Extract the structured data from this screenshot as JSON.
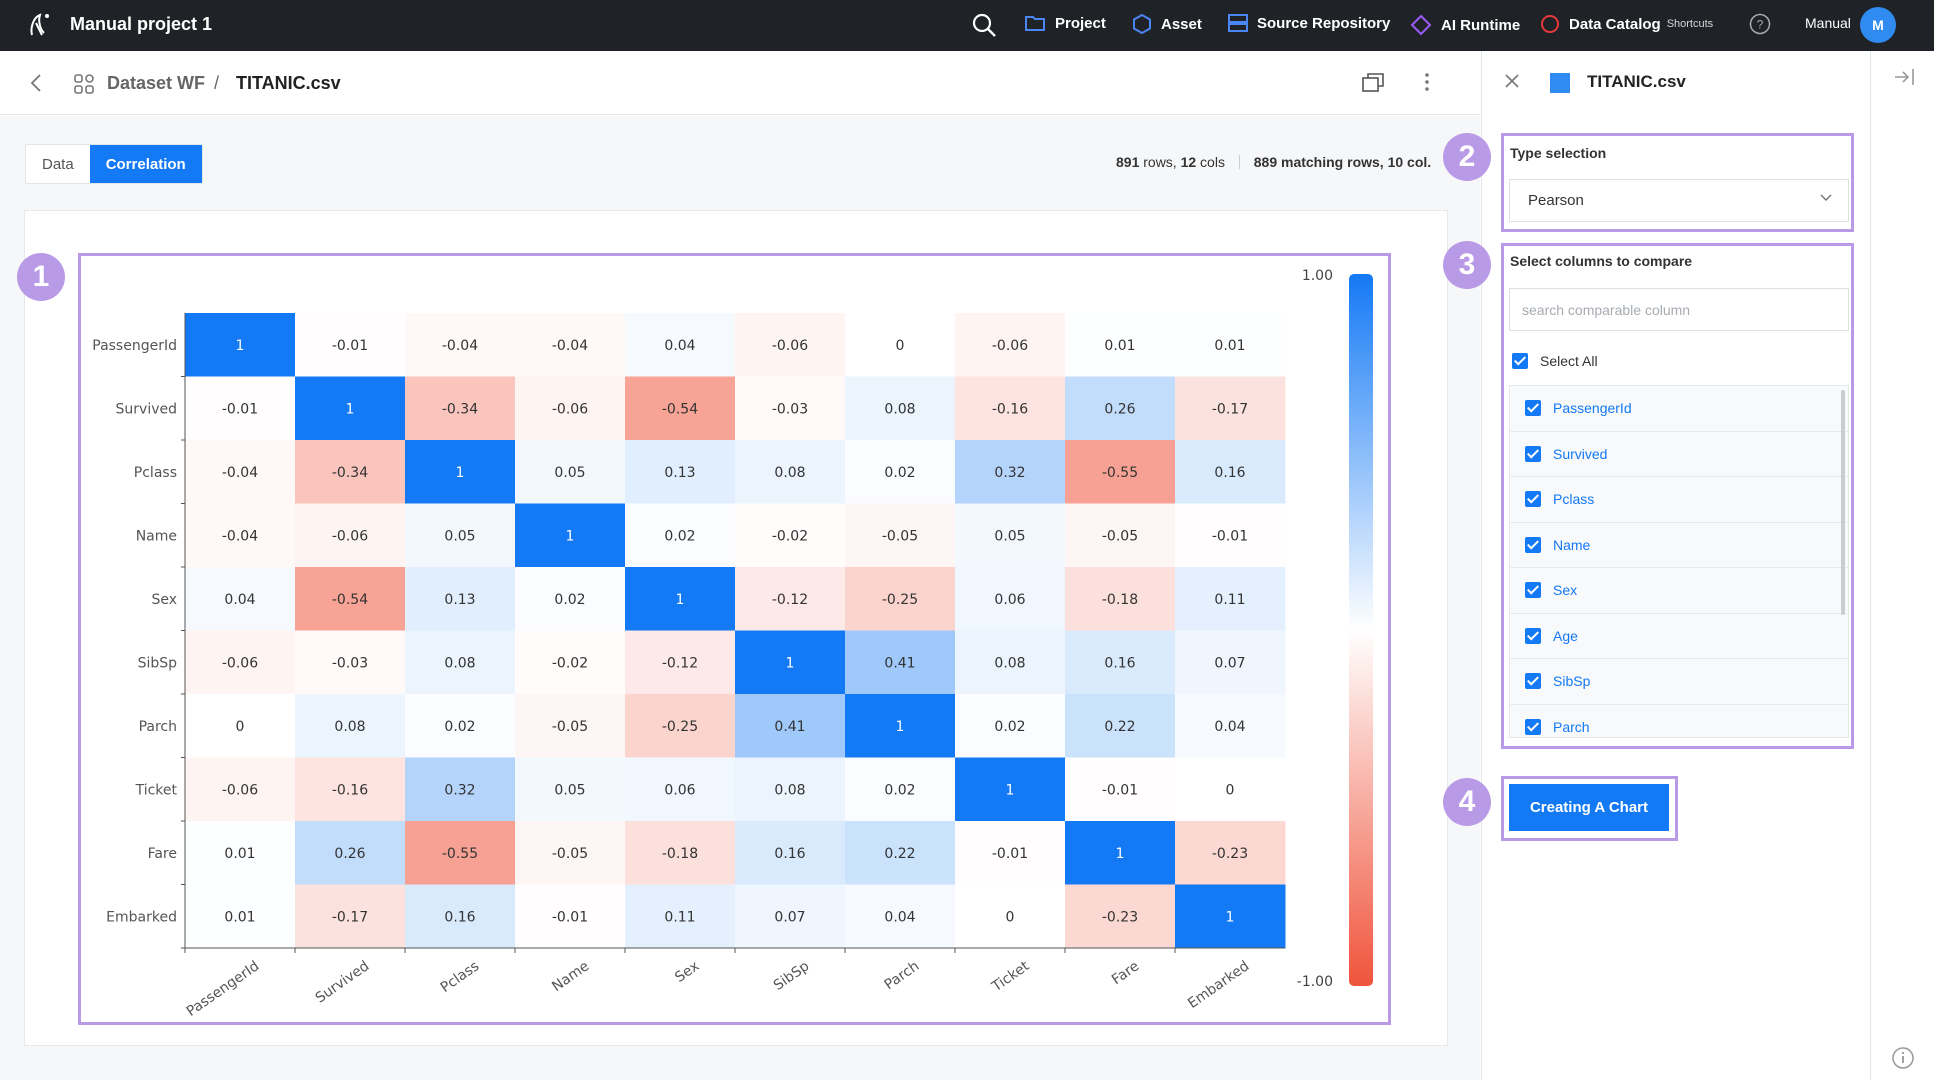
{
  "topbar": {
    "project_title": "Manual project 1",
    "nav": [
      {
        "label": "Project",
        "icon": "folder-icon"
      },
      {
        "label": "Asset",
        "icon": "hexagon-icon"
      },
      {
        "label": "Source Repository",
        "icon": "repository-icon"
      },
      {
        "label": "AI Runtime",
        "icon": "diamond-icon"
      },
      {
        "label": "Data Catalog",
        "icon": "catalog-icon"
      }
    ],
    "shortcuts_label": "Shortcuts",
    "user_name": "Manual",
    "avatar_initial": "M"
  },
  "breadcrumb": {
    "parent": "Dataset WF",
    "separator": "/",
    "current": "TITANIC.csv"
  },
  "tabs": [
    {
      "label": "Data",
      "active": false
    },
    {
      "label": "Correlation",
      "active": true
    }
  ],
  "row_info": {
    "rows": "891",
    "rows_label": " rows, ",
    "cols": "12",
    "cols_label": " cols",
    "matching": "889 matching rows, 10 col."
  },
  "badges": [
    "1",
    "2",
    "3",
    "4"
  ],
  "colors": {
    "accent": "#1479f5",
    "positive": "#1479f5",
    "negative": "#f0543c",
    "highlight": "#b99ae6",
    "topbar": "#1f2227"
  },
  "chart_data": {
    "type": "heatmap",
    "labels": [
      "PassengerId",
      "Survived",
      "Pclass",
      "Name",
      "Sex",
      "SibSp",
      "Parch",
      "Ticket",
      "Fare",
      "Embarked"
    ],
    "values": [
      [
        1,
        -0.01,
        -0.04,
        -0.04,
        0.04,
        -0.06,
        0,
        -0.06,
        0.01,
        0.01
      ],
      [
        -0.01,
        1,
        -0.34,
        -0.06,
        -0.54,
        -0.03,
        0.08,
        -0.16,
        0.26,
        -0.17
      ],
      [
        -0.04,
        -0.34,
        1,
        0.05,
        0.13,
        0.08,
        0.02,
        0.32,
        -0.55,
        0.16
      ],
      [
        -0.04,
        -0.06,
        0.05,
        1,
        0.02,
        -0.02,
        -0.05,
        0.05,
        -0.05,
        -0.01
      ],
      [
        0.04,
        -0.54,
        0.13,
        0.02,
        1,
        -0.12,
        -0.25,
        0.06,
        -0.18,
        0.11
      ],
      [
        -0.06,
        -0.03,
        0.08,
        -0.02,
        -0.12,
        1,
        0.41,
        0.08,
        0.16,
        0.07
      ],
      [
        0,
        0.08,
        0.02,
        -0.05,
        -0.25,
        0.41,
        1,
        0.02,
        0.22,
        0.04
      ],
      [
        -0.06,
        -0.16,
        0.32,
        0.05,
        0.06,
        0.08,
        0.02,
        1,
        -0.01,
        0
      ],
      [
        0.01,
        0.26,
        -0.55,
        -0.05,
        -0.18,
        0.16,
        0.22,
        -0.01,
        1,
        -0.23
      ],
      [
        0.01,
        -0.17,
        0.16,
        -0.01,
        0.11,
        0.07,
        0.04,
        0,
        -0.23,
        1
      ]
    ],
    "color_scale": {
      "max_label": "1.00",
      "min_label": "-1.00",
      "max": 1,
      "min": -1
    },
    "title": "",
    "xlabel": "",
    "ylabel": ""
  },
  "panel": {
    "title": "TITANIC.csv",
    "type_selection_label": "Type selection",
    "type_selection_value": "Pearson",
    "columns_label": "Select columns to compare",
    "search_placeholder": "search comparable column",
    "select_all_label": "Select All",
    "columns": [
      "PassengerId",
      "Survived",
      "Pclass",
      "Name",
      "Sex",
      "Age",
      "SibSp",
      "Parch"
    ],
    "create_button": "Creating A Chart"
  }
}
